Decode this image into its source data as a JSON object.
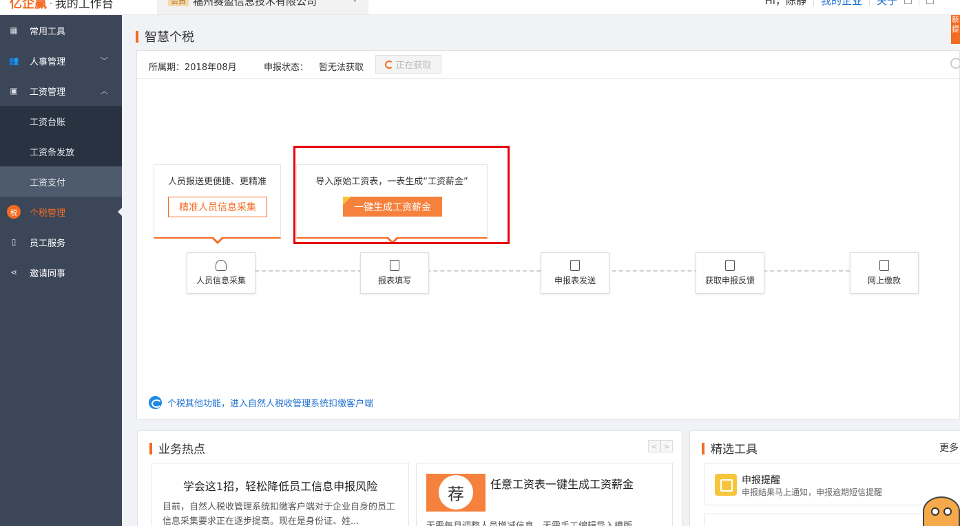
{
  "topbar": {
    "logo": "亿企赢",
    "workspace": "我的工作台",
    "company_badge": "会员",
    "company_name": "福州赛盈信息技术有限公司",
    "user_greeting": "Hi，陈静",
    "my_company_link": "我的企业",
    "about_link": "关于"
  },
  "sidebar": {
    "items": [
      {
        "label": "常用工具",
        "icon": "dashboard-icon"
      },
      {
        "label": "人事管理",
        "icon": "people-icon",
        "expanded": false
      },
      {
        "label": "工资管理",
        "icon": "wallet-icon",
        "expanded": true
      },
      {
        "label": "工资台账",
        "sub": true
      },
      {
        "label": "工资条发放",
        "sub": true
      },
      {
        "label": "工资支付",
        "sub": true,
        "active": true
      },
      {
        "label": "个税管理",
        "icon": "tax-icon",
        "current": true,
        "icon_text": "税"
      },
      {
        "label": "员工服务",
        "icon": "phone-icon"
      },
      {
        "label": "邀请同事",
        "icon": "share-icon"
      }
    ]
  },
  "page": {
    "title": "智慧个税",
    "side_tag": "新提"
  },
  "info": {
    "period": "所属期：2018年08月",
    "status_label": "申报状态：",
    "status_value": "暂无法获取",
    "fetch_button": "正在获取"
  },
  "callouts": {
    "first_text": "人员报送更便捷、更精准",
    "first_button": "精准人员信息采集",
    "second_text": "导入原始工资表，一表生成“工资薪金”",
    "second_button": "一键生成工资薪金",
    "second_badge": "荐"
  },
  "steps": [
    {
      "label": "人员信息采集",
      "icon": "person-icon"
    },
    {
      "label": "报表填写",
      "icon": "form-icon"
    },
    {
      "label": "申报表发送",
      "icon": "send-form-icon"
    },
    {
      "label": "获取申报反馈",
      "icon": "download-form-icon"
    },
    {
      "label": "网上缴款",
      "icon": "payment-icon"
    }
  ],
  "bottom_link": "个税其他功能，进入自然人税收管理系统扣缴客户端",
  "hot": {
    "title": "业务热点",
    "prev": "<",
    "next": ">",
    "news1_title": "学会这1招，轻松降低员工信息申报风险",
    "news1_desc": "目前，自然人税收管理系统扣缴客户端对于企业自身的员工信息采集要求正在逐步提高。现在是身份证、姓...",
    "news2_title": "任意工资表一键生成工资薪金",
    "news2_thumb": "荐",
    "news2_desc": "无需每月调整人员增减信息，无需手工编辑导入模版"
  },
  "tools": {
    "title": "精选工具",
    "more": "更多",
    "tool1_title": "申报提醒",
    "tool1_desc": "申报结果马上通知，申报逾期短信提醒"
  },
  "colors": {
    "accent": "#f36b21",
    "sidebar": "#3b4658",
    "highlight": "#e5000b",
    "link": "#1e6fd0"
  }
}
